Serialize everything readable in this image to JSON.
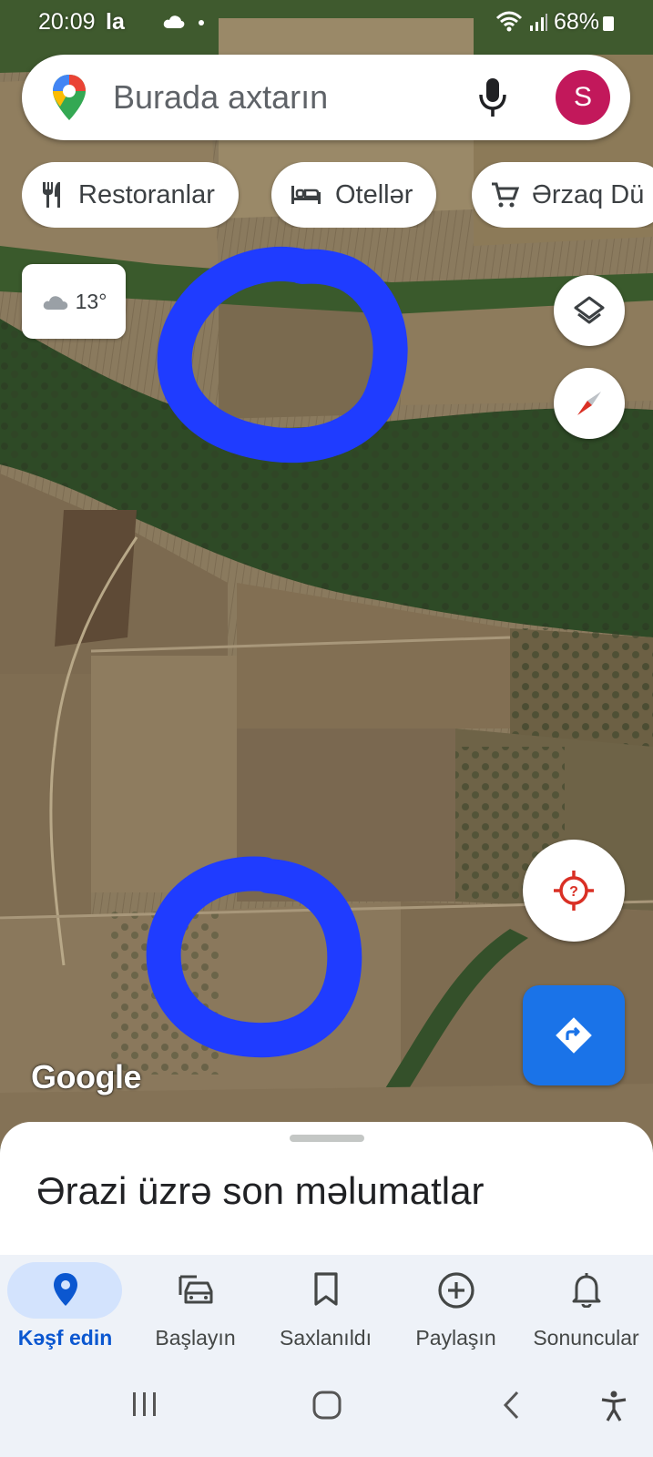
{
  "status_bar": {
    "time": "20:09",
    "carrier_badge": "la",
    "battery": "68%",
    "icons": [
      "cloud-icon",
      "wifi-icon",
      "signal-icon",
      "battery-icon"
    ]
  },
  "search": {
    "placeholder": "Burada axtarın",
    "avatar_letter": "S",
    "avatar_color": "#c2185b"
  },
  "chips": [
    {
      "label": "Restoranlar",
      "icon": "fork-knife-icon"
    },
    {
      "label": "Otellər",
      "icon": "bed-icon"
    },
    {
      "label": "Ərzaq Dü",
      "icon": "cart-icon"
    }
  ],
  "weather": {
    "temp": "13°",
    "icon": "cloud-icon"
  },
  "map": {
    "attribution": "Google",
    "view": "satellite",
    "annotations": [
      "blue-circle-top",
      "blue-circle-bottom"
    ]
  },
  "sheet": {
    "title": "Ərazi üzrə son məlumatlar"
  },
  "bottom_nav": [
    {
      "label": "Kəşf edin",
      "icon": "pin-icon",
      "active": true
    },
    {
      "label": "Başlayın",
      "icon": "car-icon",
      "active": false
    },
    {
      "label": "Saxlanıldı",
      "icon": "bookmark-icon",
      "active": false
    },
    {
      "label": "Paylaşın",
      "icon": "add-circle-icon",
      "active": false
    },
    {
      "label": "Sonuncular",
      "icon": "bell-icon",
      "active": false
    }
  ],
  "colors": {
    "accent": "#1a73e8",
    "annotation": "#1f3cff",
    "active_nav": "#0b57d0"
  }
}
